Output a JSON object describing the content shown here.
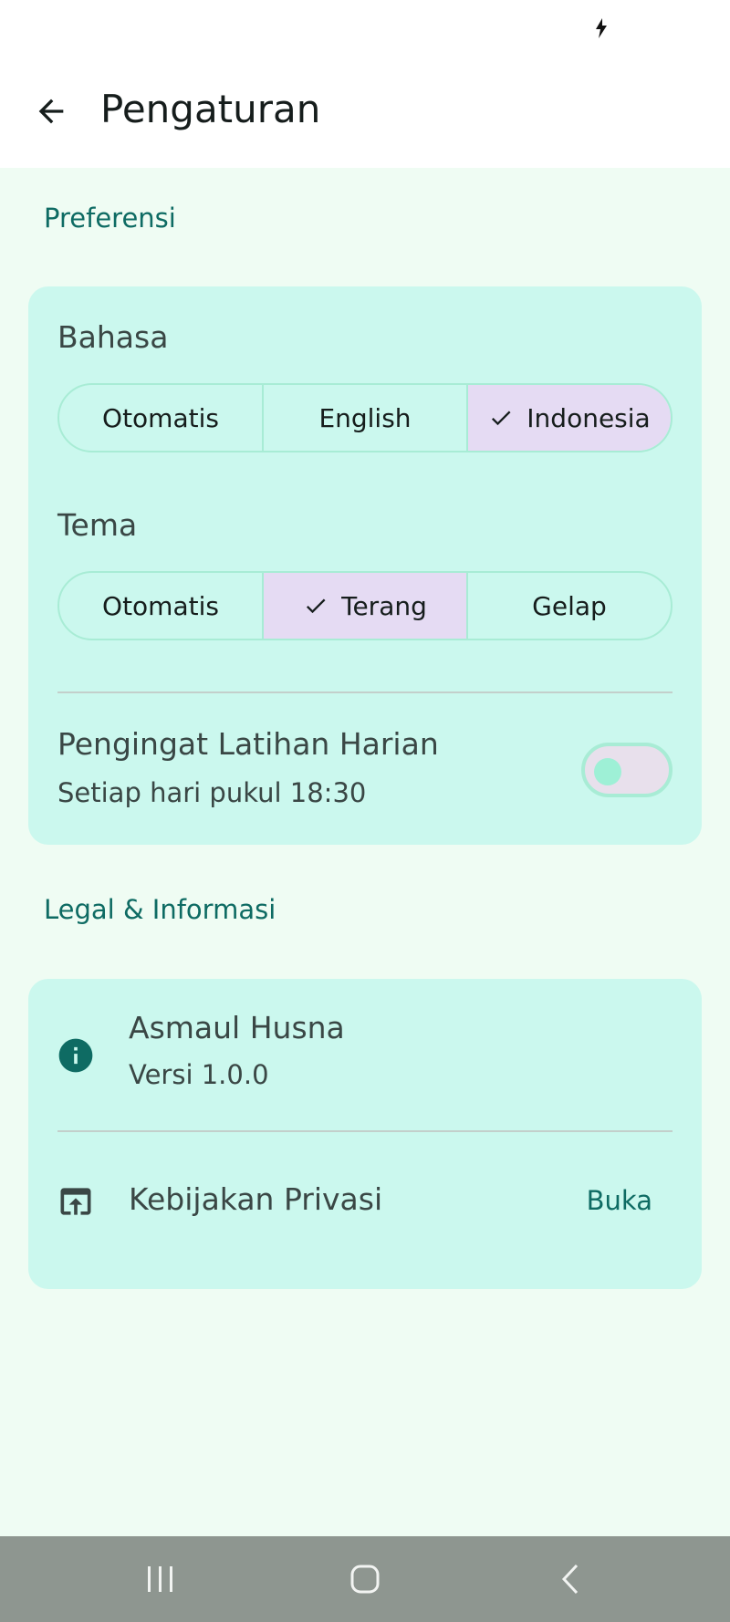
{
  "app_bar": {
    "title": "Pengaturan",
    "back_icon": "arrow-left-icon"
  },
  "preferences": {
    "header": "Preferensi",
    "language": {
      "label": "Bahasa",
      "options": [
        "Otomatis",
        "English",
        "Indonesia"
      ],
      "selected": "Indonesia"
    },
    "theme": {
      "label": "Tema",
      "options": [
        "Otomatis",
        "Terang",
        "Gelap"
      ],
      "selected": "Terang"
    },
    "reminder": {
      "title": "Pengingat Latihan Harian",
      "subtitle": "Setiap hari pukul 18:30",
      "enabled": false
    }
  },
  "legal": {
    "header": "Legal & Informasi",
    "app_info": {
      "icon": "info-icon",
      "title": "Asmaul Husna",
      "version": "Versi 1.0.0"
    },
    "privacy": {
      "icon": "open-in-browser-icon",
      "title": "Kebijakan Privasi",
      "action": "Buka"
    }
  },
  "colors": {
    "accent": "#0e6b63",
    "card": "#cbf8ee",
    "background": "#effcf3",
    "selected_segment": "#e5dbf3"
  }
}
